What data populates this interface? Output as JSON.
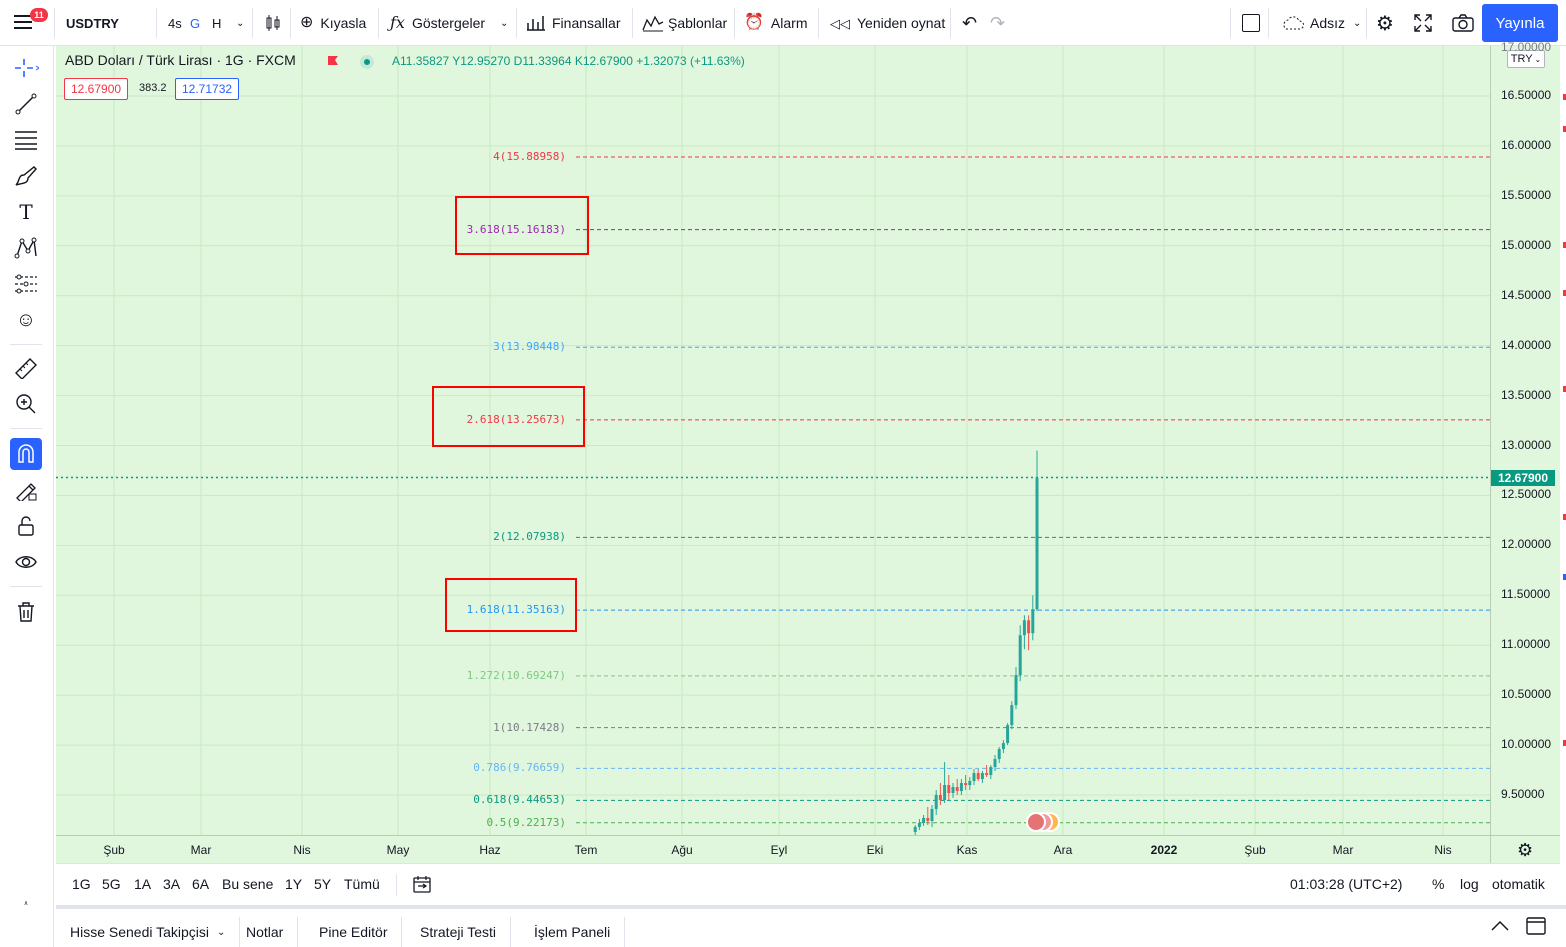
{
  "topbar": {
    "notification_count": "11",
    "symbol": "USDTRY",
    "intervals": [
      "4s",
      "G",
      "H"
    ],
    "compare": "Kıyasla",
    "indicators": "Göstergeler",
    "financials": "Finansallar",
    "templates": "Şablonlar",
    "alert": "Alarm",
    "replay": "Yeniden oynat",
    "layout_name": "Adsız",
    "publish": "Yayınla"
  },
  "legend": {
    "title": "ABD Doları / Türk Lirası · 1G · FXCM",
    "ohlc": "A11.35827 Y12.95270 D11.33964 K12.67900 +1.32073 (+11.63%)",
    "bid": "12.67900",
    "spread": "383.2",
    "ask": "12.71732"
  },
  "price_scale": {
    "currency": "TRY",
    "top_partial": "17.00000",
    "ticks": [
      "16.50000",
      "16.00000",
      "15.50000",
      "15.00000",
      "14.50000",
      "14.00000",
      "13.50000",
      "13.00000",
      "12.50000",
      "12.00000",
      "11.50000",
      "11.00000",
      "10.50000",
      "10.00000",
      "9.50000"
    ],
    "last_price": "12.67900",
    "last_price_color": "#089981"
  },
  "fib_levels": [
    {
      "label": "4(15.88958)",
      "value": 15.88958,
      "color": "#f23645"
    },
    {
      "label": "3.618(15.16183)",
      "value": 15.16183,
      "color": "#9c27b0"
    },
    {
      "label": "3(13.98448)",
      "value": 13.98448,
      "color": "#42a5f5"
    },
    {
      "label": "2.618(13.25673)",
      "value": 13.25673,
      "color": "#f23645"
    },
    {
      "label": "2(12.07938)",
      "value": 12.07938,
      "color": "#089981"
    },
    {
      "label": "1.618(11.35163)",
      "value": 11.35163,
      "color": "#2196f3"
    },
    {
      "label": "1.272(10.69247)",
      "value": 10.69247,
      "color": "#81c784"
    },
    {
      "label": "1(10.17428)",
      "value": 10.17428,
      "color": "#787b86"
    },
    {
      "label": "0.786(9.76659)",
      "value": 9.76659,
      "color": "#64b5f6"
    },
    {
      "label": "0.618(9.44653)",
      "value": 9.44653,
      "color": "#089981"
    },
    {
      "label": "0.5(9.22173)",
      "value": 9.22173,
      "color": "#4caf50"
    }
  ],
  "time_scale": [
    "Şub",
    "Mar",
    "Nis",
    "May",
    "Haz",
    "Tem",
    "Ağu",
    "Eyl",
    "Eki",
    "Kas",
    "Ara",
    "2022",
    "Şub",
    "Mar",
    "Nis"
  ],
  "candles": [
    [
      9.13,
      9.2,
      9.1,
      9.18
    ],
    [
      9.18,
      9.26,
      9.15,
      9.22
    ],
    [
      9.22,
      9.3,
      9.19,
      9.27
    ],
    [
      9.27,
      9.38,
      9.2,
      9.24
    ],
    [
      9.24,
      9.4,
      9.18,
      9.36
    ],
    [
      9.36,
      9.55,
      9.3,
      9.5
    ],
    [
      9.5,
      9.62,
      9.4,
      9.45
    ],
    [
      9.45,
      9.83,
      9.42,
      9.6
    ],
    [
      9.6,
      9.7,
      9.45,
      9.52
    ],
    [
      9.52,
      9.62,
      9.47,
      9.58
    ],
    [
      9.58,
      9.66,
      9.5,
      9.54
    ],
    [
      9.54,
      9.66,
      9.5,
      9.62
    ],
    [
      9.62,
      9.7,
      9.55,
      9.6
    ],
    [
      9.6,
      9.68,
      9.55,
      9.64
    ],
    [
      9.64,
      9.76,
      9.6,
      9.72
    ],
    [
      9.72,
      9.76,
      9.64,
      9.66
    ],
    [
      9.66,
      9.74,
      9.62,
      9.72
    ],
    [
      9.72,
      9.8,
      9.68,
      9.7
    ],
    [
      9.7,
      9.8,
      9.66,
      9.78
    ],
    [
      9.78,
      9.9,
      9.74,
      9.86
    ],
    [
      9.86,
      9.98,
      9.82,
      9.96
    ],
    [
      9.96,
      10.05,
      9.92,
      10.02
    ],
    [
      10.02,
      10.22,
      10.0,
      10.2
    ],
    [
      10.2,
      10.44,
      10.16,
      10.4
    ],
    [
      10.4,
      10.78,
      10.36,
      10.7
    ],
    [
      10.7,
      11.2,
      10.64,
      11.1
    ],
    [
      11.1,
      11.3,
      10.96,
      11.25
    ],
    [
      11.25,
      11.3,
      10.95,
      11.12
    ],
    [
      11.12,
      11.5,
      11.05,
      11.36
    ],
    [
      11.36,
      12.95,
      11.34,
      12.68
    ]
  ],
  "range_bar": {
    "ranges": [
      "1G",
      "5G",
      "1A",
      "3A",
      "6A",
      "Bu sene",
      "1Y",
      "5Y",
      "Tümü"
    ],
    "clock": "01:03:28 (UTC+2)",
    "percent": "%",
    "log": "log",
    "auto": "otomatik"
  },
  "panels": [
    "Hisse Senedi Takipçisi",
    "Notlar",
    "Pine Editör",
    "Strateji Testi",
    "İşlem Paneli"
  ]
}
